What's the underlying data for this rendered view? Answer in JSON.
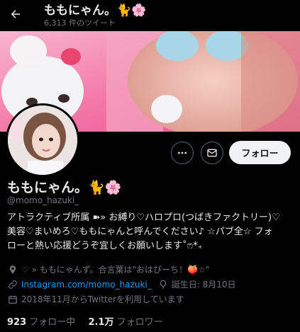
{
  "header": {
    "title": "ももにゃん。🐈🌸",
    "tweet_count": "6,313 件のツイート",
    "back_icon": "arrow-left-icon"
  },
  "profile": {
    "name": "ももにゃん。🐈🌸",
    "handle": "@momo_hazuki_",
    "follow_label": "フォロー",
    "more_icon": "more-dots-icon",
    "message_icon": "envelope-icon",
    "bio_lines": [
      "アトラクティブ所属 ➽» お縛り♡ハロプロ(つばきファクトリー)♡",
      "美容♡まいめろ♡ももにゃんと呼んでください♪ ☆パブ全☆ フォ",
      "ローと熱い応援どうぞ宜しくお願いします˚ෆ*₊"
    ],
    "location": "♡ » ももにゃんず。合言葉は\"おはぴーち！🍑☆\"",
    "website": "Instagram.com/momo_hazuki_",
    "birthday": "誕生日: 8月10日",
    "joined": "2018年11月からTwitterを利用しています",
    "following_count": "923",
    "following_label": "フォロー中",
    "followers_count": "2.1万",
    "followers_label": "フォロワー"
  },
  "colors": {
    "background": "#000000",
    "text": "#e7e9ea",
    "muted": "#71767b",
    "link": "#1d9bf0",
    "banner_pink": "#f25f9b"
  }
}
